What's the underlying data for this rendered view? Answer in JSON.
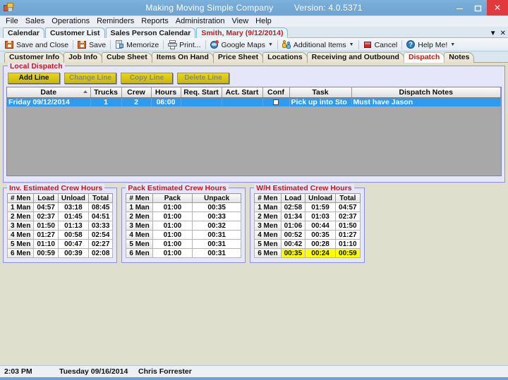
{
  "window": {
    "app_icon": "app-logo-icon",
    "title": "Making Moving Simple Company",
    "version_label": "Version: 4.0.5371",
    "minimize": "–",
    "maximize": "❐",
    "close": "✕"
  },
  "menubar": {
    "items": [
      "File",
      "Sales",
      "Operations",
      "Reminders",
      "Reports",
      "Administration",
      "View",
      "Help"
    ]
  },
  "document_tabs": {
    "items": [
      {
        "label": "Calendar",
        "active": false
      },
      {
        "label": "Customer List",
        "active": false
      },
      {
        "label": "Sales Person Calendar",
        "active": false
      },
      {
        "label": "Smith, Mary  (9/12/2014)",
        "active": true
      }
    ],
    "dropdown_glyph": "▼",
    "close_glyph": "✕"
  },
  "toolbar": {
    "items": [
      {
        "label": "Save and Close",
        "icon": "save-icon",
        "caret": false
      },
      {
        "label": "Save",
        "icon": "save-icon",
        "caret": false
      },
      {
        "label": "Memorize",
        "icon": "memorize-icon",
        "caret": false
      },
      {
        "label": "Print...",
        "icon": "printer-icon",
        "caret": false
      },
      {
        "label": "Google Maps",
        "icon": "globe-pin-icon",
        "caret": true
      },
      {
        "label": "Additional Items",
        "icon": "people-icon",
        "caret": true
      },
      {
        "label": "Cancel",
        "icon": "cancel-icon",
        "caret": false
      },
      {
        "label": "Help Me!",
        "icon": "help-icon",
        "caret": true
      }
    ],
    "help_glyph": "?",
    "caret_glyph": "▼"
  },
  "sub_tabs": {
    "items": [
      {
        "label": "Customer Info",
        "active": false
      },
      {
        "label": "Job Info",
        "active": false
      },
      {
        "label": "Cube Sheet",
        "active": false
      },
      {
        "label": "Items On Hand",
        "active": false
      },
      {
        "label": "Price Sheet",
        "active": false
      },
      {
        "label": "Locations",
        "active": false
      },
      {
        "label": "Receiving and Outbound",
        "active": false
      },
      {
        "label": "Dispatch",
        "active": true
      },
      {
        "label": "Notes",
        "active": false
      }
    ]
  },
  "dispatch": {
    "legend": "Local Dispatch",
    "buttons": [
      {
        "label": "Add Line",
        "enabled": true
      },
      {
        "label": "Change Line",
        "enabled": false
      },
      {
        "label": "Copy Line",
        "enabled": false
      },
      {
        "label": "Delete Line",
        "enabled": false
      }
    ],
    "columns": [
      "Date",
      "Trucks",
      "Crew",
      "Hours",
      "Req. Start",
      "Act. Start",
      "Conf",
      "Task",
      "Dispatch Notes"
    ],
    "sorted_column": "Date",
    "rows": [
      {
        "date": "Friday  09/12/2014",
        "trucks": "1",
        "crew": "2",
        "hours": "06:00",
        "req_start": "",
        "act_start": "",
        "conf_checked": false,
        "task": "Pick up into Sto",
        "notes": "Must have Jason",
        "selected": true
      }
    ]
  },
  "crew_hours": [
    {
      "legend": "Inv. Estimated Crew Hours",
      "columns": [
        "# Men",
        "Load",
        "Unload",
        "Total"
      ],
      "rows": [
        {
          "men": "1 Man",
          "cells": [
            "04:57",
            "03:18",
            "08:45"
          ],
          "highlight": false
        },
        {
          "men": "2 Men",
          "cells": [
            "02:37",
            "01:45",
            "04:51"
          ],
          "highlight": false
        },
        {
          "men": "3 Men",
          "cells": [
            "01:50",
            "01:13",
            "03:33"
          ],
          "highlight": false
        },
        {
          "men": "4 Men",
          "cells": [
            "01:27",
            "00:58",
            "02:54"
          ],
          "highlight": false
        },
        {
          "men": "5 Men",
          "cells": [
            "01:10",
            "00:47",
            "02:27"
          ],
          "highlight": false
        },
        {
          "men": "6 Men",
          "cells": [
            "00:59",
            "00:39",
            "02:08"
          ],
          "highlight": false
        }
      ]
    },
    {
      "legend": "Pack Estimated Crew Hours",
      "columns": [
        "# Men",
        "Pack",
        "Unpack"
      ],
      "rows": [
        {
          "men": "1 Man",
          "cells": [
            "01:00",
            "00:35"
          ],
          "highlight": false
        },
        {
          "men": "2 Men",
          "cells": [
            "01:00",
            "00:33"
          ],
          "highlight": false
        },
        {
          "men": "3 Men",
          "cells": [
            "01:00",
            "00:32"
          ],
          "highlight": false
        },
        {
          "men": "4 Men",
          "cells": [
            "01:00",
            "00:31"
          ],
          "highlight": false
        },
        {
          "men": "5 Men",
          "cells": [
            "01:00",
            "00:31"
          ],
          "highlight": false
        },
        {
          "men": "6 Men",
          "cells": [
            "01:00",
            "00:31"
          ],
          "highlight": false
        }
      ]
    },
    {
      "legend": "W/H Estimated Crew Hours",
      "columns": [
        "# Men",
        "Load",
        "Unload",
        "Total"
      ],
      "rows": [
        {
          "men": "1 Man",
          "cells": [
            "02:58",
            "01:59",
            "04:57"
          ],
          "highlight": false
        },
        {
          "men": "2 Men",
          "cells": [
            "01:34",
            "01:03",
            "02:37"
          ],
          "highlight": false
        },
        {
          "men": "3 Men",
          "cells": [
            "01:06",
            "00:44",
            "01:50"
          ],
          "highlight": false
        },
        {
          "men": "4 Men",
          "cells": [
            "00:52",
            "00:35",
            "01:27"
          ],
          "highlight": false
        },
        {
          "men": "5 Men",
          "cells": [
            "00:42",
            "00:28",
            "01:10"
          ],
          "highlight": false
        },
        {
          "men": "6 Men",
          "cells": [
            "00:35",
            "00:24",
            "00:59"
          ],
          "highlight": true
        }
      ]
    }
  ],
  "statusbar": {
    "time": "2:03 PM",
    "date": "Tuesday 09/16/2014",
    "user": "Chris Forrester"
  },
  "colors": {
    "titlebar": "#6fa4d2",
    "close_button": "#e0393e",
    "group_border": "#8f8fe0",
    "group_fill": "#e6e6fa",
    "legend_text": "#cc1414",
    "button_yellow": "#d7c512",
    "row_selected": "#2e9bf0",
    "highlight_yellow": "#ffff00",
    "page_background": "#dfdfcd",
    "active_tab_text": "#d91212"
  }
}
